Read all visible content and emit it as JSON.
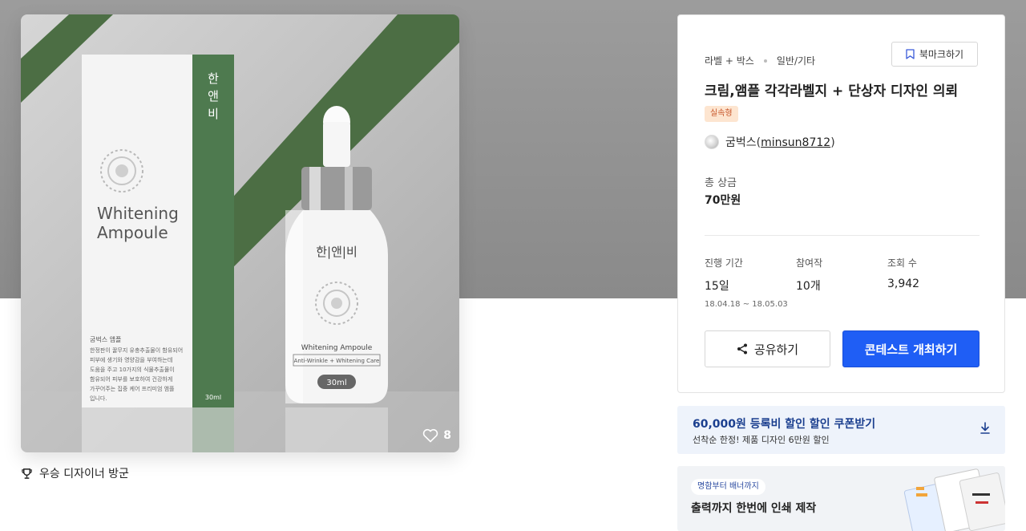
{
  "product": {
    "brand_name": "한|앤|비",
    "box_title_line1": "Whitening",
    "box_title_line2": "Ampoule",
    "box_desc_title": "굼벅스 앰플",
    "box_desc_lines": [
      "한정판이 꿀무지 유충추출물이 함유되어",
      "피부에 생기와 영양감을 부여하는데",
      "도움을 주고 10가지의 식물추출물이",
      "함유되어 피부를 보호하여 건강하게",
      "가꾸어주는 집중 케어 프리미엄 앰플",
      "입니다."
    ],
    "box_volume": "30ml",
    "bottle_label": "Whitening Ampoule",
    "bottle_sublabel": "Anti-Wrinkle + Whitening Care",
    "bottle_volume": "30ml",
    "likes": "8"
  },
  "award": {
    "label": "우승 디자이너 방군"
  },
  "contest": {
    "category1": "라벨 + 박스",
    "category2": "일반/기타",
    "bookmark_label": "북마크하기",
    "title": "크림,앰플 각각라벨지 + 단상자 디자인 의뢰",
    "badge": "실속형",
    "owner_name": "굼벅스",
    "owner_id": "minsun8712",
    "prize_label": "총 상금",
    "prize_value": "70만원",
    "stats": {
      "period_label": "진행 기간",
      "period_value": "15일",
      "period_dates": "18.04.18 ~ 18.05.03",
      "participants_label": "참여작",
      "participants_value": "10개",
      "views_label": "조회 수",
      "views_value": "3,942"
    },
    "share_label": "공유하기",
    "host_label": "콘테스트 개최하기"
  },
  "coupon": {
    "title": "60,000원 등록비 할인 할인 쿠폰받기",
    "subtitle": "선착순 한정! 제품 디자인 6만원 할인"
  },
  "print_banner": {
    "pill": "명함부터 배너까지",
    "title": "출력까지 한번에 인쇄 제작"
  },
  "colors": {
    "accent_blue": "#1f5ef5",
    "box_green": "#4e7a4f",
    "badge_bg": "#fde5d0",
    "badge_text": "#c8562a"
  }
}
